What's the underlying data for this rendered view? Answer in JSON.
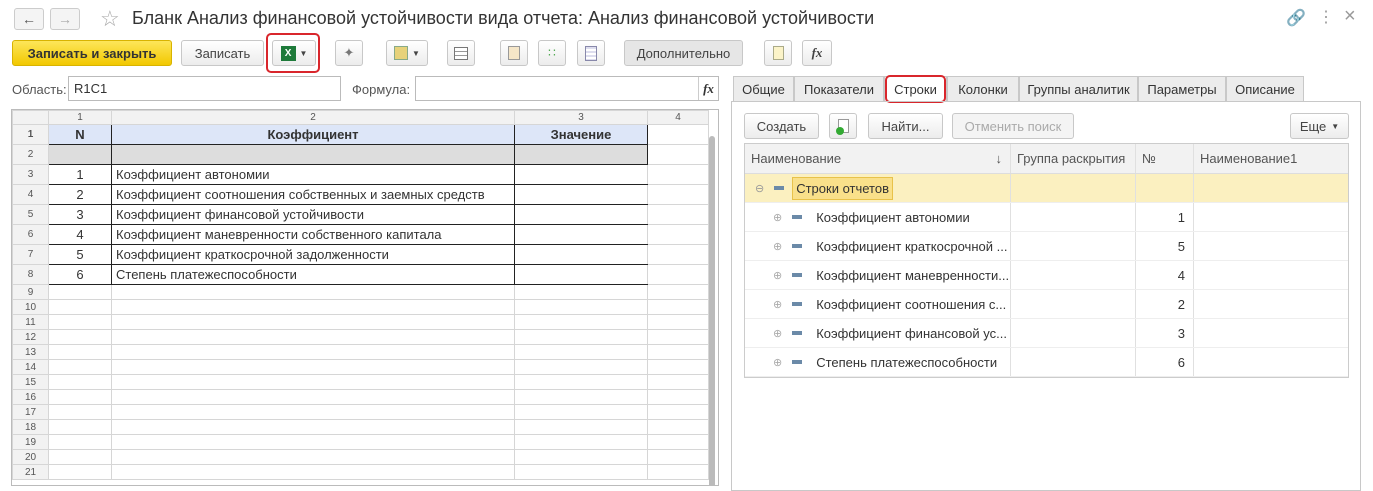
{
  "window": {
    "title": "Бланк Анализ финансовой устойчивости вида отчета: Анализ финансовой устойчивости"
  },
  "toolbar": {
    "save_close": "Записать и закрыть",
    "save": "Записать",
    "more": "Дополнительно",
    "fx": "fx"
  },
  "fields": {
    "area_label": "Область:",
    "area_value": "R1C1",
    "formula_label": "Формула:",
    "formula_value": ""
  },
  "sheet": {
    "col_headers": [
      "1",
      "2",
      "3",
      "4"
    ],
    "header": {
      "n": "N",
      "name": "Коэффициент",
      "value": "Значение"
    },
    "rows": [
      {
        "n": "1",
        "name": "Коэффициент автономии"
      },
      {
        "n": "2",
        "name": "Коэффициент соотношения собственных и заемных средств"
      },
      {
        "n": "3",
        "name": "Коэффициент финансовой устойчивости"
      },
      {
        "n": "4",
        "name": "Коэффициент маневренности собственного капитала"
      },
      {
        "n": "5",
        "name": "Коэффициент краткосрочной задолженности"
      },
      {
        "n": "6",
        "name": "Степень платежеспособности"
      }
    ],
    "row_numbers": [
      "1",
      "2",
      "3",
      "4",
      "5",
      "6",
      "7",
      "8",
      "9",
      "10",
      "11",
      "12",
      "13",
      "14",
      "15",
      "16",
      "17",
      "18",
      "19",
      "20",
      "21"
    ]
  },
  "tabs": [
    "Общие",
    "Показатели",
    "Строки",
    "Колонки",
    "Группы аналитик",
    "Параметры",
    "Описание"
  ],
  "active_tab": "Строки",
  "panel": {
    "create": "Создать",
    "find": "Найти...",
    "cancel_search": "Отменить поиск",
    "more": "Еще"
  },
  "tree": {
    "columns": [
      "Наименование",
      "Группа раскрытия",
      "№",
      "Наименование1"
    ],
    "sort_indicator": "↓",
    "group": "Строки отчетов",
    "items": [
      {
        "name": "Коэффициент автономии",
        "num": "1"
      },
      {
        "name": "Коэффициент краткосрочной ...",
        "num": "5"
      },
      {
        "name": "Коэффициент маневренности...",
        "num": "4"
      },
      {
        "name": "Коэффициент соотношения с...",
        "num": "2"
      },
      {
        "name": "Коэффициент финансовой ус...",
        "num": "3"
      },
      {
        "name": "Степень платежеспособности",
        "num": "6"
      }
    ]
  },
  "colors": {
    "primary": "#f6d31a",
    "highlight": "#d9262c",
    "selection": "#fbf0c0"
  }
}
